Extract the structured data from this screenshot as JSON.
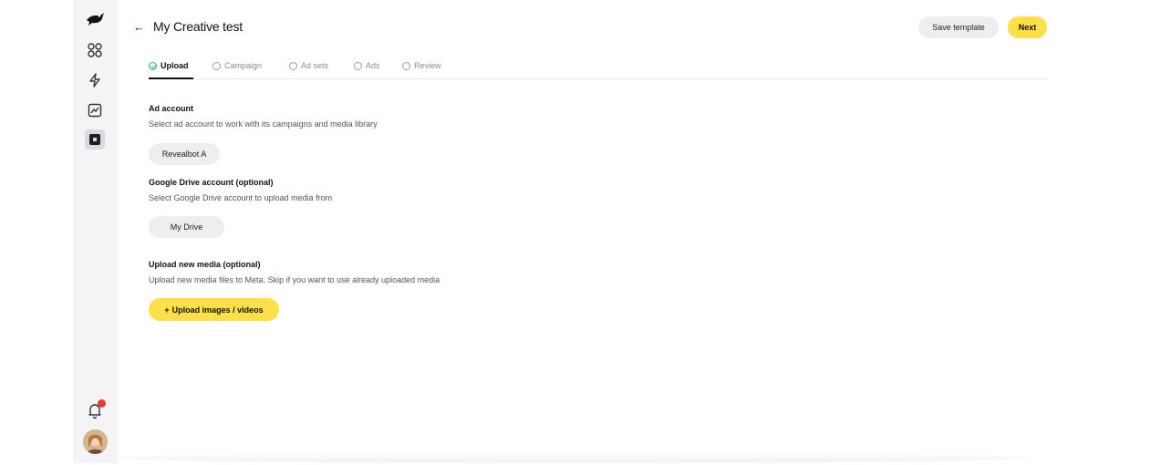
{
  "header": {
    "back_icon": "←",
    "title": "My Creative test",
    "save_template_label": "Save template",
    "next_label": "Next"
  },
  "sidebar": {
    "items": [
      {
        "icon": "bird-logo-icon"
      },
      {
        "icon": "grid-icon"
      },
      {
        "icon": "lightning-icon"
      },
      {
        "icon": "chart-icon"
      },
      {
        "icon": "creative-icon",
        "active": true
      }
    ],
    "notification_icon": "bell-icon",
    "avatar": "user-avatar"
  },
  "tabs": [
    {
      "label": "Upload",
      "active": true
    },
    {
      "label": "Campaign"
    },
    {
      "label": "Ad sets"
    },
    {
      "label": "Ads"
    },
    {
      "label": "Review"
    }
  ],
  "sections": {
    "ad_account": {
      "title": "Ad account",
      "desc": "Select ad account to work with its campaigns and media library",
      "value": "Revealbot A"
    },
    "google_drive": {
      "title": "Google Drive account (optional)",
      "desc": "Select Google Drive account to upload media from",
      "value": "My Drive"
    },
    "upload_media": {
      "title": "Upload new media (optional)",
      "desc": "Upload new media files to Meta. Skip if you want to use already uploaded media",
      "button_label": "Upload images / videos",
      "button_icon": "+"
    }
  },
  "colors": {
    "accent_yellow": "#fde047",
    "sidebar_bg": "#f4f4f6",
    "success_green": "#3bb56a",
    "badge_red": "#e5392b"
  }
}
